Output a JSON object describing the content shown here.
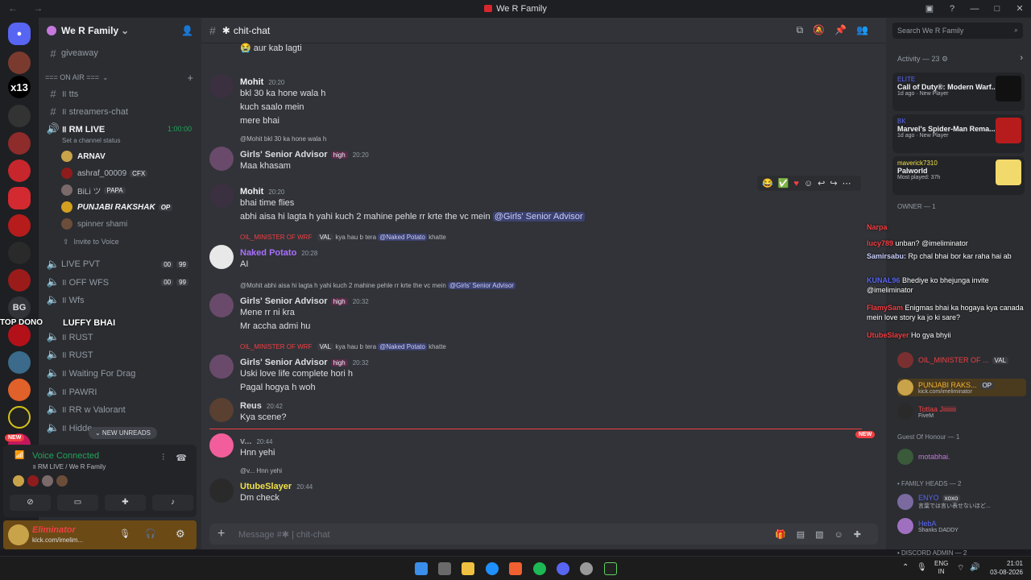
{
  "window": {
    "title": "We R Family",
    "nav": "← →",
    "buttons": [
      "▣",
      "?",
      "—",
      "□",
      "✕"
    ]
  },
  "servers": {
    "badge_x13": "x13",
    "bg": "BG",
    "new_badge": "NEW"
  },
  "guild": {
    "name": "We R Family",
    "chevron": "⌄"
  },
  "channels": {
    "giveaway": "giveaway",
    "on_air": "=== ON AIR ===",
    "tts": "॥ tts",
    "streamers": "॥ streamers-chat",
    "rm_live": "॥ RM LIVE",
    "rm_live_time": "1:00:00",
    "set_status": "Set a channel status",
    "invite": "Invite to Voice",
    "live_pvt": "LIVE PVT",
    "off_wfs": "॥ OFF WFS",
    "wfs": "॥ Wfs",
    "rust1": "॥ RUST",
    "rust2": "॥ RUST",
    "waiting": "॥ Waiting For Drag",
    "pawri": "॥ PAWRI",
    "rr": "॥ RR w Valorant",
    "hidden": "॥ Hidde...",
    "new_unreads": "⌄  NEW UNREADS",
    "counts": [
      "00",
      "99",
      "00",
      "99"
    ]
  },
  "voice_members": [
    {
      "name": "ARNAV",
      "color": "#f2f3f5",
      "tag": ""
    },
    {
      "name": "ashraf_00009",
      "color": "#b5bac1",
      "tag": "CFX"
    },
    {
      "name": "BiLi ツ",
      "color": "#b5bac1",
      "tag": "PAPA"
    },
    {
      "name": "PUNJABI RAKSHAK",
      "color": "#f2f3f5",
      "tag": "OP"
    },
    {
      "name": "spinner shami",
      "color": "#949ba4",
      "tag": ""
    }
  ],
  "overlay": {
    "top_dono": "TOP DONO",
    "luffy": "LUFFY BHAI"
  },
  "voice": {
    "status": "Voice Connected",
    "channel": "॥ RM LIVE / We R Family"
  },
  "user": {
    "name": "Eliminator",
    "status": "kick.com/imelim..."
  },
  "chat": {
    "channel": "chit-chat",
    "composer_placeholder": "Message #✱ | chit-chat",
    "new_label": "NEW",
    "messages": [
      {
        "top_line": "😭 aur kab lagti"
      },
      {
        "user": "Mohit",
        "time": "20:20",
        "lines": [
          "bkl 30 ka hone wala h",
          "kuch saalo mein",
          "mere bhai"
        ]
      },
      {
        "reply_user": "@Mohit",
        "reply": "bkl 30 ka hone wala h",
        "user": "Girls' Senior Advisor",
        "role": "high",
        "time": "20:20",
        "lines": [
          "Maa khasam"
        ]
      },
      {
        "user": "Mohit",
        "time": "20:20",
        "lines": [
          "bhai time flies",
          "abhi aisa hi lagta h yahi kuch 2 mahine pehle rr krte the vc mein"
        ],
        "mention": "@Girls' Senior Advisor"
      },
      {
        "reply_user": "OIL_MINISTER OF WRF",
        "reply_tag": "VAL",
        "reply": "kya hau b tera",
        "reply_mention": "@Naked Potato",
        "reply_tail": "khatte",
        "user": "Naked Potato",
        "time": "20:28",
        "lines": [
          "AI"
        ]
      },
      {
        "reply_user": "@Mohit",
        "reply": "abhi aisa hi lagta h yahi kuch 2 mahine pehle rr krte the vc mein",
        "reply_mention": "@Girls' Senior Advisor",
        "user": "Girls' Senior Advisor",
        "role": "high",
        "time": "20:32",
        "lines": [
          "Mene rr ni kra",
          "Mr accha admi hu"
        ]
      },
      {
        "reply_user": "OIL_MINISTER OF WRF",
        "reply_tag": "VAL",
        "reply": "kya hau b tera",
        "reply_mention": "@Naked Potato",
        "reply_tail": "khatte",
        "user": "Girls' Senior Advisor",
        "role": "high",
        "time": "20:32",
        "lines": [
          "Uski love life complete hori h",
          "Pagal hogya h woh"
        ]
      },
      {
        "user": "Reus",
        "time": "20:42",
        "lines": [
          "Kya scene?"
        ]
      },
      {
        "user": "v...",
        "time": "20:44",
        "lines": [
          "Hnn yehi"
        ]
      },
      {
        "reply_user": "@v...",
        "reply": "Hnn yehi",
        "user": "UtubeSlayer",
        "time": "20:44",
        "lines": [
          "Dm check"
        ]
      }
    ]
  },
  "aside": {
    "search": "Search We R Family",
    "activity_title": "Activity — 23",
    "activities": [
      {
        "label": "ELITE",
        "title": "Call of Duty®: Modern Warf...",
        "sub": "1d ago · New Player"
      },
      {
        "label": "BK",
        "title": "Marvel's Spider-Man Rema...",
        "sub": "1d ago · New Player"
      },
      {
        "label": "maverick7310",
        "title": "Palworld",
        "sub": "Most played: 37h"
      }
    ],
    "owner": "OWNER — 1",
    "guest": "Guest Of Honour — 1",
    "family_heads": "• FAMILY HEADS — 2",
    "discord_admin": "• DISCORD ADMIN — 2",
    "members": [
      {
        "name": "OIL_MINISTER OF ...",
        "tag": "VAL",
        "color": "#f23f43"
      },
      {
        "name": "PUNJABI RAKS...",
        "tag": "OP",
        "color": "#f0b232"
      },
      {
        "name": "Totlaa Jiiiiiiii",
        "tag": "",
        "color": "#f23f43"
      },
      {
        "name": "motabhai.",
        "tag": "",
        "color": "#c678dd"
      },
      {
        "name": "ENYO",
        "tag": "xoxo",
        "color": "#5865f2"
      },
      {
        "name": "HebA",
        "tag": "",
        "color": "#5865f2"
      }
    ],
    "member_subs": [
      "kick.com/imeliminator",
      "FiveM",
      "言葉では言い表せないほど...",
      "Shanks DADDY"
    ]
  },
  "stream_chat": [
    {
      "user": "Narpa",
      "msg": ""
    },
    {
      "user": "lucy789",
      "msg": "unban? @imeliminator"
    },
    {
      "user": "Samirsabu:",
      "msg": "Rp chal bhai bor kar raha hai ab"
    },
    {
      "user": "KUNAL96",
      "msg": "Bhediye ko bhejunga invite @imeliminator"
    },
    {
      "user": "FlamySam",
      "msg": "Enigmas bhai ka hogaya kya canada mein love story ka jo ki sare?"
    },
    {
      "user": "UtubeSlayer",
      "msg": "Ho gya bhyii"
    }
  ],
  "taskbar": {
    "lang1": "ENG",
    "lang2": "IN",
    "time": "21:01",
    "date": "03-08-2026"
  }
}
